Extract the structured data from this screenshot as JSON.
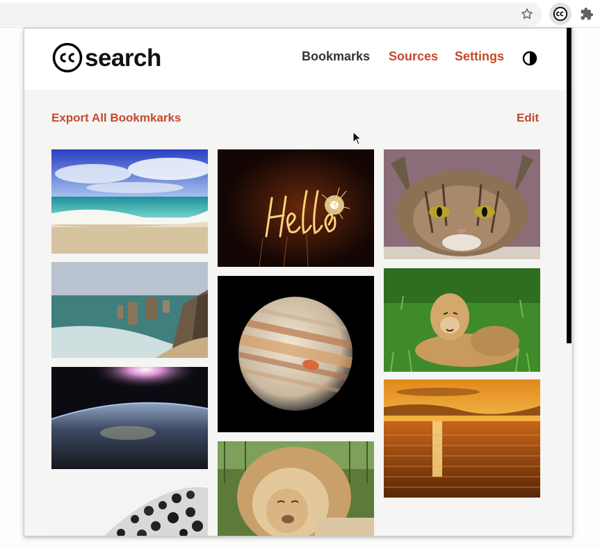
{
  "popup": {
    "brand": {
      "logo_text": "search"
    },
    "nav": {
      "bookmarks_label": "Bookmarks",
      "sources_label": "Sources",
      "settings_label": "Settings"
    },
    "actions": {
      "export_label": "Export All Bookmkarks",
      "edit_label": "Edit"
    },
    "bookmarks": [
      {
        "name": "beach-waves",
        "icon": "image-thumbnail"
      },
      {
        "name": "coastal-rock-stacks",
        "icon": "image-thumbnail"
      },
      {
        "name": "earth-from-space",
        "icon": "image-thumbnail"
      },
      {
        "name": "leopard-fur",
        "icon": "image-thumbnail"
      },
      {
        "name": "hello-sparkler",
        "icon": "image-thumbnail"
      },
      {
        "name": "jupiter",
        "icon": "image-thumbnail"
      },
      {
        "name": "lion-resting",
        "icon": "image-thumbnail"
      },
      {
        "name": "wildcat",
        "icon": "image-thumbnail"
      },
      {
        "name": "lioness-on-grass",
        "icon": "image-thumbnail"
      },
      {
        "name": "ocean-sunset",
        "icon": "image-thumbnail"
      }
    ]
  },
  "colors": {
    "accent": "#c5492c",
    "nav_text": "#333333",
    "popup_background": "#f5f5f4",
    "header_background": "#ffffff"
  },
  "icons": {
    "toolbar": [
      "bookmark-star-icon",
      "cc-extension-icon",
      "extensions-puzzle-icon"
    ],
    "header": [
      "cc-logo-icon",
      "contrast-toggle-icon"
    ]
  }
}
